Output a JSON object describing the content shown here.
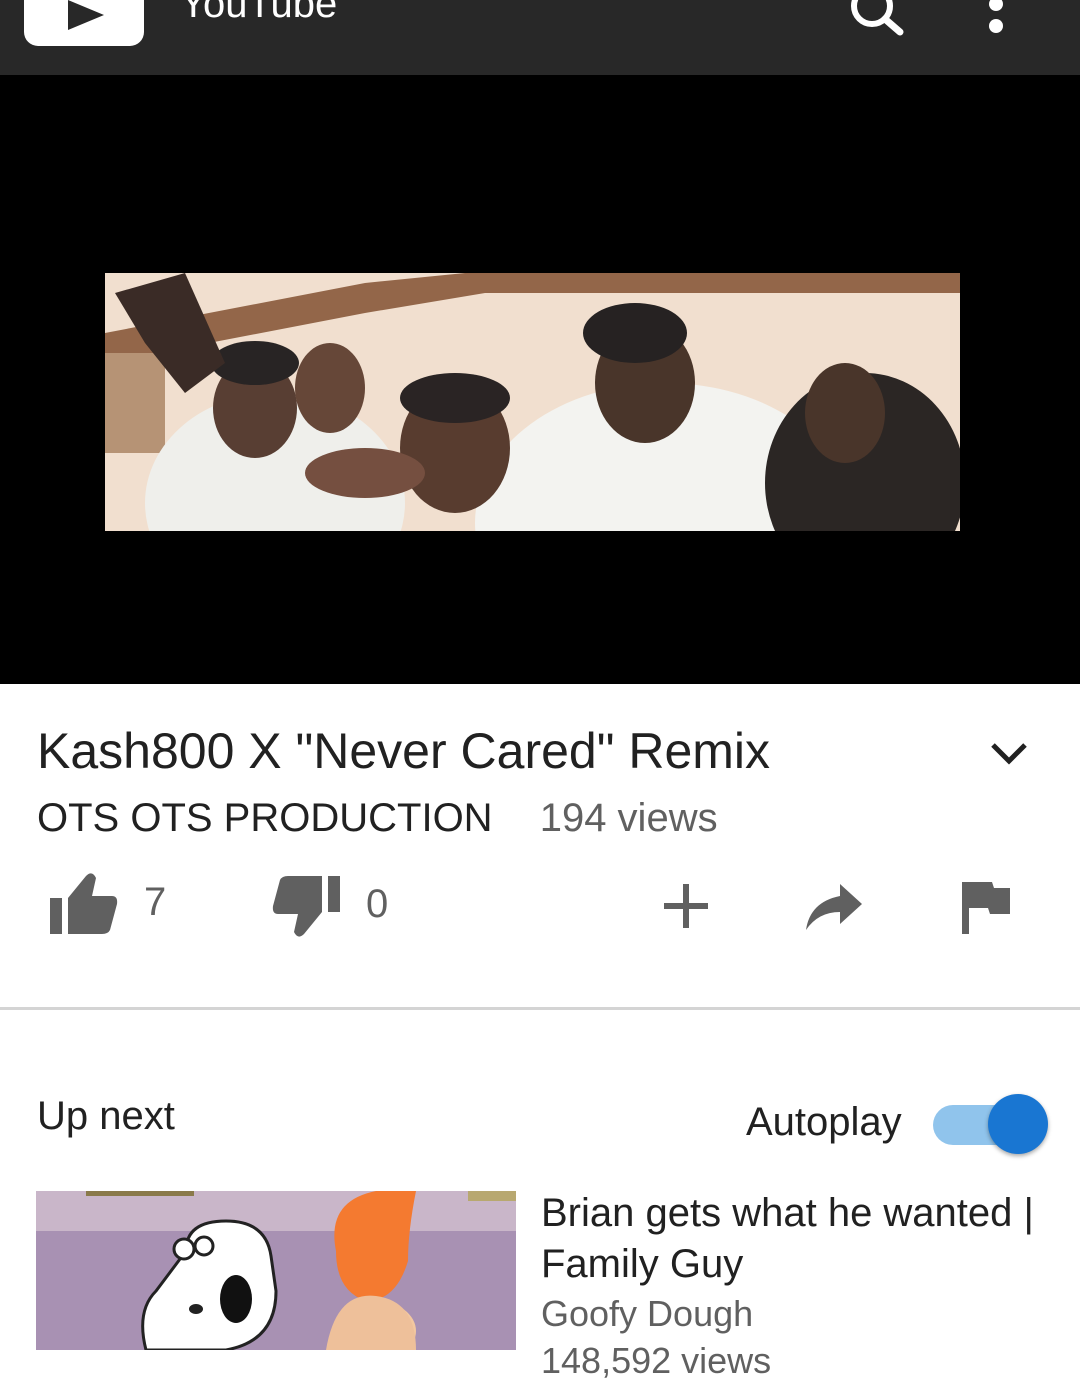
{
  "app": {
    "logo_text": "YouTube"
  },
  "topbar": {
    "search_icon": "search-icon",
    "more_icon": "more-vert-icon",
    "background": "#282828"
  },
  "video": {
    "title": "Kash800 X \"Never Cared\" Remix",
    "channel": "OTS OTS PRODUCTION",
    "views": "194 views",
    "likes": "7",
    "dislikes": "0"
  },
  "actions": {
    "icons": [
      "thumb-up-icon",
      "thumb-down-icon",
      "add-icon",
      "share-icon",
      "flag-icon"
    ]
  },
  "up_next": {
    "heading": "Up next",
    "autoplay_label": "Autoplay",
    "autoplay_on": true,
    "accent": "#1976d2",
    "items": [
      {
        "title": "Brian gets what he wanted | Family Guy",
        "channel": "Goofy Dough",
        "views": "148,592 views"
      }
    ]
  }
}
